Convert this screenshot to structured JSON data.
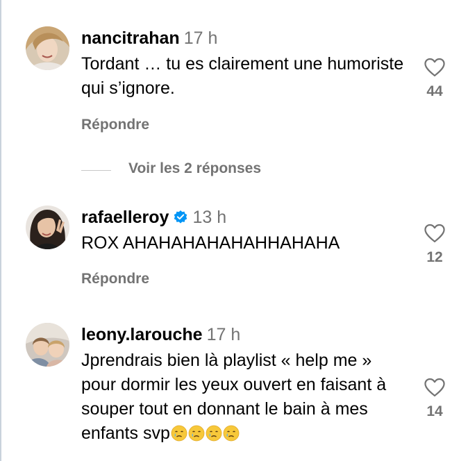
{
  "comments": [
    {
      "username": "nancitrahan",
      "time": "17 h",
      "text": "Tordant … tu es clairement une humoriste qui s’ignore.",
      "reply_label": "Répondre",
      "likes": "44",
      "verified": false
    },
    {
      "username": "rafaelleroy",
      "time": "13 h",
      "text": "ROX AHAHAHAHAHAHHAHAHA",
      "reply_label": "Répondre",
      "likes": "12",
      "verified": true
    },
    {
      "username": "leony.larouche",
      "time": "17 h",
      "text": "Jprendrais bien là playlist « help me » pour dormir les yeux ouvert en faisant à souper tout en donnant le bain à mes enfants svp",
      "likes": "14",
      "verified": false,
      "trailing_emoji": [
        "crying-face",
        "crying-face",
        "crying-face",
        "crying-face"
      ]
    }
  ],
  "view_replies": "Voir les 2 réponses",
  "colors": {
    "muted": "#737373",
    "verified_blue": "#0095f6",
    "divider": "#c7c7c7"
  }
}
